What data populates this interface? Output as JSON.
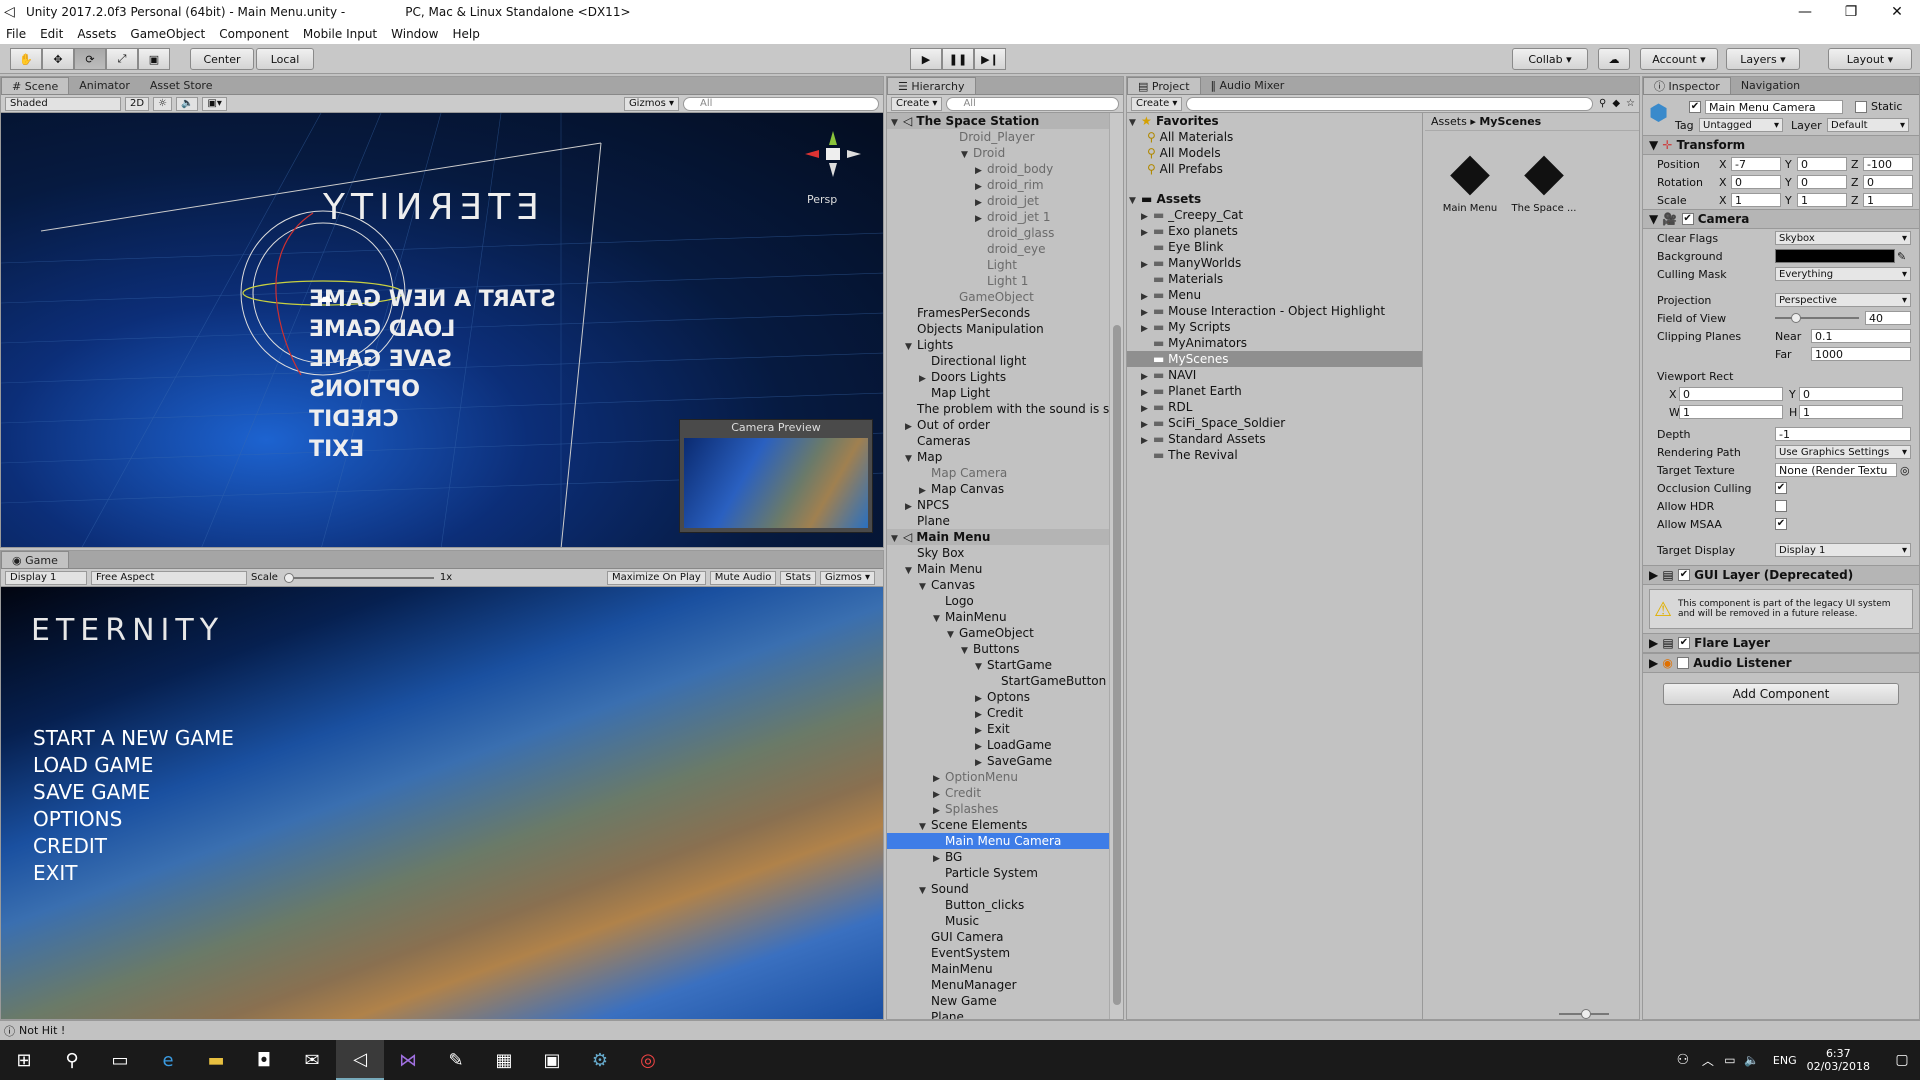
{
  "window": {
    "title": "Unity 2017.2.0f3 Personal (64bit) - Main Menu.unity -",
    "platform": "PC, Mac & Linux Standalone <DX11>"
  },
  "menu": [
    "File",
    "Edit",
    "Assets",
    "GameObject",
    "Component",
    "Mobile Input",
    "Window",
    "Help"
  ],
  "toolbar": {
    "center": "Center",
    "local": "Local",
    "collab": "Collab",
    "account": "Account",
    "layers": "Layers",
    "layout": "Layout"
  },
  "scene": {
    "tabs": [
      "Scene",
      "Animator",
      "Asset Store"
    ],
    "shading": "Shaded",
    "mode2d": "2D",
    "gizmos": "Gizmos",
    "search_placeholder": "All",
    "persp": "Persp",
    "logo": "ETERNITY",
    "menu_items": [
      "START A NEW GAME",
      "LOAD GAME",
      "SAVE GAME",
      "OPTIONS",
      "CREDIT",
      "EXIT"
    ],
    "camera_preview": "Camera Preview"
  },
  "game": {
    "tab": "Game",
    "display": "Display 1",
    "aspect": "Free Aspect",
    "scale_label": "Scale",
    "scale_value": "1x",
    "maximize": "Maximize On Play",
    "mute": "Mute Audio",
    "stats": "Stats",
    "gizmos": "Gizmos",
    "logo": "ETERNITY",
    "menu_items": [
      "START A NEW GAME",
      "LOAD GAME",
      "SAVE GAME",
      "OPTIONS",
      "CREDIT",
      "EXIT"
    ]
  },
  "hierarchy": {
    "tab": "Hierarchy",
    "create": "Create",
    "search_placeholder": "All",
    "rows": [
      {
        "t": "The Space Station",
        "d": 0,
        "a": "▼",
        "k": "scene"
      },
      {
        "t": "Droid_Player",
        "d": 4,
        "a": "",
        "k": "grey"
      },
      {
        "t": "Droid",
        "d": 5,
        "a": "▼",
        "k": "grey"
      },
      {
        "t": "droid_body",
        "d": 6,
        "a": "▶",
        "k": "grey"
      },
      {
        "t": "droid_rim",
        "d": 6,
        "a": "▶",
        "k": "grey"
      },
      {
        "t": "droid_jet",
        "d": 6,
        "a": "▶",
        "k": "grey"
      },
      {
        "t": "droid_jet 1",
        "d": 6,
        "a": "▶",
        "k": "grey"
      },
      {
        "t": "droid_glass",
        "d": 6,
        "a": "",
        "k": "grey"
      },
      {
        "t": "droid_eye",
        "d": 6,
        "a": "",
        "k": "grey"
      },
      {
        "t": "Light",
        "d": 6,
        "a": "",
        "k": "grey"
      },
      {
        "t": "Light 1",
        "d": 6,
        "a": "",
        "k": "grey"
      },
      {
        "t": "GameObject",
        "d": 4,
        "a": "",
        "k": "grey"
      },
      {
        "t": "FramesPerSeconds",
        "d": 1,
        "a": "",
        "k": ""
      },
      {
        "t": "Objects Manipulation",
        "d": 1,
        "a": "",
        "k": ""
      },
      {
        "t": "Lights",
        "d": 1,
        "a": "▼",
        "k": ""
      },
      {
        "t": "Directional light",
        "d": 2,
        "a": "",
        "k": ""
      },
      {
        "t": "Doors Lights",
        "d": 2,
        "a": "▶",
        "k": ""
      },
      {
        "t": "Map Light",
        "d": 2,
        "a": "",
        "k": ""
      },
      {
        "t": "The problem with the sound is sor",
        "d": 1,
        "a": "",
        "k": ""
      },
      {
        "t": "Out of order",
        "d": 1,
        "a": "▶",
        "k": ""
      },
      {
        "t": "Cameras",
        "d": 1,
        "a": "",
        "k": ""
      },
      {
        "t": "Map",
        "d": 1,
        "a": "▼",
        "k": ""
      },
      {
        "t": "Map Camera",
        "d": 2,
        "a": "",
        "k": "grey"
      },
      {
        "t": "Map Canvas",
        "d": 2,
        "a": "▶",
        "k": ""
      },
      {
        "t": "NPCS",
        "d": 1,
        "a": "▶",
        "k": ""
      },
      {
        "t": "Plane",
        "d": 1,
        "a": "",
        "k": ""
      },
      {
        "t": "Main Menu",
        "d": 0,
        "a": "▼",
        "k": "scene"
      },
      {
        "t": "Sky Box",
        "d": 1,
        "a": "",
        "k": ""
      },
      {
        "t": "Main Menu",
        "d": 1,
        "a": "▼",
        "k": ""
      },
      {
        "t": "Canvas",
        "d": 2,
        "a": "▼",
        "k": ""
      },
      {
        "t": "Logo",
        "d": 3,
        "a": "",
        "k": ""
      },
      {
        "t": "MainMenu",
        "d": 3,
        "a": "▼",
        "k": ""
      },
      {
        "t": "GameObject",
        "d": 4,
        "a": "▼",
        "k": ""
      },
      {
        "t": "Buttons",
        "d": 5,
        "a": "▼",
        "k": ""
      },
      {
        "t": "StartGame",
        "d": 6,
        "a": "▼",
        "k": ""
      },
      {
        "t": "StartGameButton",
        "d": 7,
        "a": "",
        "k": ""
      },
      {
        "t": "Optons",
        "d": 6,
        "a": "▶",
        "k": ""
      },
      {
        "t": "Credit",
        "d": 6,
        "a": "▶",
        "k": ""
      },
      {
        "t": "Exit",
        "d": 6,
        "a": "▶",
        "k": ""
      },
      {
        "t": "LoadGame",
        "d": 6,
        "a": "▶",
        "k": ""
      },
      {
        "t": "SaveGame",
        "d": 6,
        "a": "▶",
        "k": ""
      },
      {
        "t": "OptionMenu",
        "d": 3,
        "a": "▶",
        "k": "grey"
      },
      {
        "t": "Credit",
        "d": 3,
        "a": "▶",
        "k": "grey"
      },
      {
        "t": "Splashes",
        "d": 3,
        "a": "▶",
        "k": "grey"
      },
      {
        "t": "Scene Elements",
        "d": 2,
        "a": "▼",
        "k": ""
      },
      {
        "t": "Main Menu Camera",
        "d": 3,
        "a": "",
        "k": "sel"
      },
      {
        "t": "BG",
        "d": 3,
        "a": "▶",
        "k": ""
      },
      {
        "t": "Particle System",
        "d": 3,
        "a": "",
        "k": ""
      },
      {
        "t": "Sound",
        "d": 2,
        "a": "▼",
        "k": ""
      },
      {
        "t": "Button_clicks",
        "d": 3,
        "a": "",
        "k": ""
      },
      {
        "t": "Music",
        "d": 3,
        "a": "",
        "k": ""
      },
      {
        "t": "GUI Camera",
        "d": 2,
        "a": "",
        "k": ""
      },
      {
        "t": "EventSystem",
        "d": 2,
        "a": "",
        "k": ""
      },
      {
        "t": "MainMenu",
        "d": 2,
        "a": "",
        "k": ""
      },
      {
        "t": "MenuManager",
        "d": 2,
        "a": "",
        "k": ""
      },
      {
        "t": "New Game",
        "d": 2,
        "a": "",
        "k": ""
      },
      {
        "t": "Plane",
        "d": 2,
        "a": "",
        "k": ""
      }
    ]
  },
  "project": {
    "tabs": [
      "Project",
      "Audio Mixer"
    ],
    "create": "Create",
    "favorites_label": "Favorites",
    "favorites": [
      "All Materials",
      "All Models",
      "All Prefabs"
    ],
    "assets_label": "Assets",
    "folders": [
      {
        "t": "_Creepy_Cat",
        "a": "▶",
        "s": false
      },
      {
        "t": "Exo planets",
        "a": "▶",
        "s": false
      },
      {
        "t": "Eye Blink",
        "a": "",
        "s": false
      },
      {
        "t": "ManyWorlds",
        "a": "▶",
        "s": false
      },
      {
        "t": "Materials",
        "a": "",
        "s": false
      },
      {
        "t": "Menu",
        "a": "▶",
        "s": false
      },
      {
        "t": "Mouse Interaction - Object Highlight",
        "a": "▶",
        "s": false
      },
      {
        "t": "My Scripts",
        "a": "▶",
        "s": false
      },
      {
        "t": "MyAnimators",
        "a": "",
        "s": false
      },
      {
        "t": "MyScenes",
        "a": "",
        "s": true
      },
      {
        "t": "NAVI",
        "a": "▶",
        "s": false
      },
      {
        "t": "Planet Earth",
        "a": "▶",
        "s": false
      },
      {
        "t": "RDL",
        "a": "▶",
        "s": false
      },
      {
        "t": "SciFi_Space_Soldier",
        "a": "▶",
        "s": false
      },
      {
        "t": "Standard Assets",
        "a": "▶",
        "s": false
      },
      {
        "t": "The Revival",
        "a": "",
        "s": false
      }
    ],
    "breadcrumb_root": "Assets",
    "breadcrumb_sep": "▸",
    "breadcrumb_current": "MyScenes",
    "files": [
      "Main Menu",
      "The Space ..."
    ]
  },
  "inspector": {
    "tabs": [
      "Inspector",
      "Navigation"
    ],
    "object_name": "Main Menu Camera",
    "static_label": "Static",
    "tag_label": "Tag",
    "tag_value": "Untagged",
    "layer_label": "Layer",
    "layer_value": "Default",
    "transform": {
      "title": "Transform",
      "position": {
        "label": "Position",
        "x": "-7",
        "y": "0",
        "z": "-100"
      },
      "rotation": {
        "label": "Rotation",
        "x": "0",
        "y": "0",
        "z": "0"
      },
      "scale": {
        "label": "Scale",
        "x": "1",
        "y": "1",
        "z": "1"
      }
    },
    "camera": {
      "title": "Camera",
      "clear_flags_label": "Clear Flags",
      "clear_flags": "Skybox",
      "background_label": "Background",
      "culling_label": "Culling Mask",
      "culling": "Everything",
      "projection_label": "Projection",
      "projection": "Perspective",
      "fov_label": "Field of View",
      "fov": "40",
      "clip_label": "Clipping Planes",
      "near_label": "Near",
      "near": "0.1",
      "far_label": "Far",
      "far": "1000",
      "viewport_label": "Viewport Rect",
      "vx": "0",
      "vy": "0",
      "vw": "1",
      "vh": "1",
      "depth_label": "Depth",
      "depth": "-1",
      "render_path_label": "Rendering Path",
      "render_path": "Use Graphics Settings",
      "target_tex_label": "Target Texture",
      "target_tex": "None (Render Textu",
      "occlusion_label": "Occlusion Culling",
      "hdr_label": "Allow HDR",
      "msaa_label": "Allow MSAA",
      "target_display_label": "Target Display",
      "target_display": "Display 1"
    },
    "gui_layer": "GUI Layer (Deprecated)",
    "gui_warning": "This component is part of the legacy UI system and will be removed in a future release.",
    "flare_layer": "Flare Layer",
    "audio_listener": "Audio Listener",
    "add_component": "Add Component"
  },
  "status": "Not Hit !",
  "taskbar": {
    "lang": "ENG",
    "time": "6:37",
    "date": "02/03/2018"
  }
}
